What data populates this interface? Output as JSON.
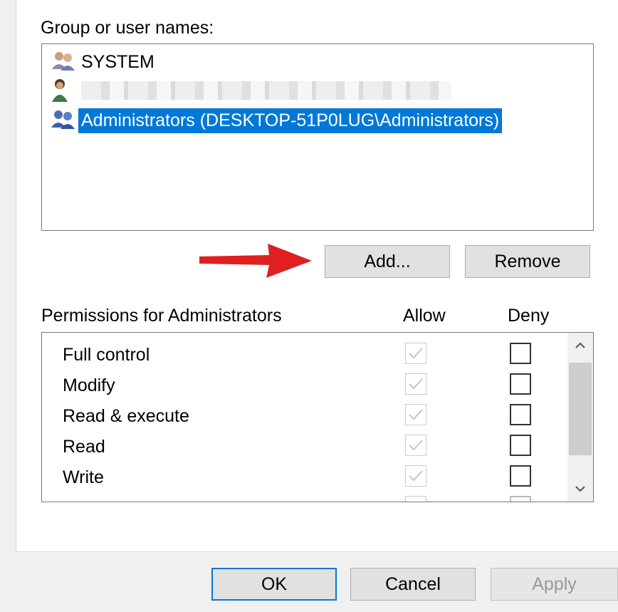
{
  "group_section": {
    "label": "Group or user names:",
    "users": [
      {
        "name": "SYSTEM",
        "icon": "group-users-icon"
      },
      {
        "name": "",
        "icon": "user-icon",
        "redacted": true
      },
      {
        "name": "Administrators (DESKTOP-51P0LUG\\Administrators)",
        "icon": "group-users-icon",
        "selected": true
      }
    ],
    "add_label": "Add...",
    "remove_label": "Remove"
  },
  "permissions": {
    "label": "Permissions for Administrators",
    "allow_header": "Allow",
    "deny_header": "Deny",
    "rows": [
      {
        "name": "Full control",
        "allow": true,
        "deny": false
      },
      {
        "name": "Modify",
        "allow": true,
        "deny": false
      },
      {
        "name": "Read & execute",
        "allow": true,
        "deny": false
      },
      {
        "name": "Read",
        "allow": true,
        "deny": false
      },
      {
        "name": "Write",
        "allow": true,
        "deny": false
      }
    ]
  },
  "footer": {
    "ok_label": "OK",
    "cancel_label": "Cancel",
    "apply_label": "Apply"
  },
  "colors": {
    "selection": "#0078d7",
    "annotation_arrow": "#e02020"
  }
}
